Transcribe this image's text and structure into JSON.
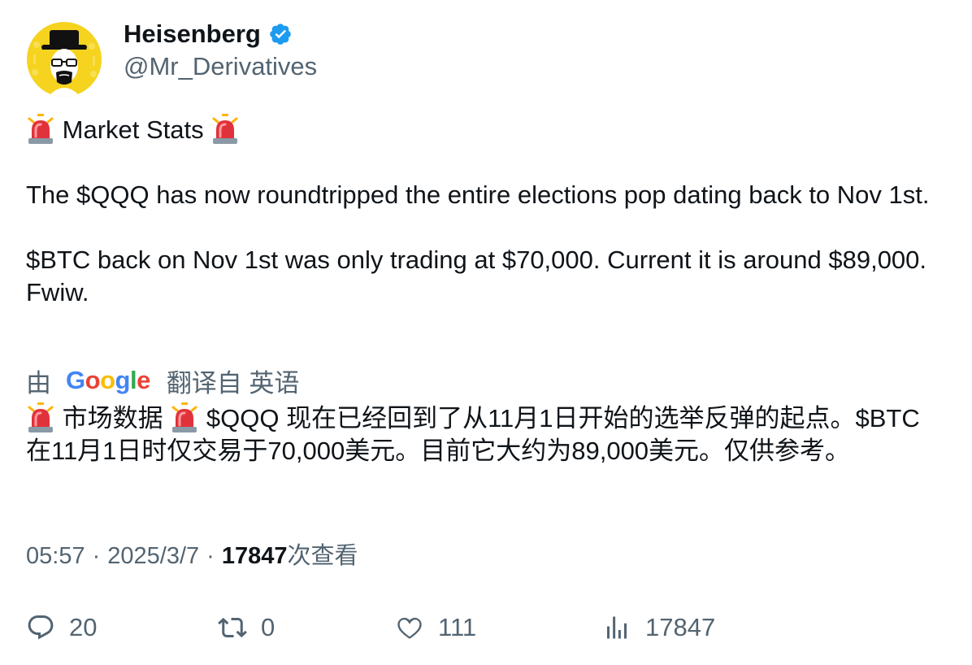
{
  "author": {
    "display_name": "Heisenberg",
    "handle": "@Mr_Derivatives",
    "verified": true,
    "verified_color": "#1d9bf0",
    "avatar_icon": "heisenberg-avatar-icon",
    "avatar_bg": "#f5d31f"
  },
  "tweet": {
    "title_line": "Market Stats",
    "paragraph_1": "The $QQQ has now roundtripped the entire elections pop dating back to Nov 1st.",
    "paragraph_2": "$BTC back on Nov 1st was only trading at $70,000. Current it is around $89,000. Fwiw.",
    "emoji": "siren-icon"
  },
  "translation": {
    "by_label": "由",
    "provider": "Google",
    "from_label": "翻译自 英语",
    "part_1": "市场数据",
    "part_2": "$QQQ 现在已经回到了从11月1日开始的选举反弹的起点。$BTC 在11月1日时仅交易于70,000美元。目前它大约为89,000美元。仅供参考。"
  },
  "meta": {
    "time": "05:57",
    "separator": "·",
    "date": "2025/3/7",
    "views": "17847",
    "views_label": "次查看"
  },
  "actions": {
    "replies": "20",
    "reposts": "0",
    "likes": "111",
    "views": "17847",
    "icon_color": "#536471"
  }
}
